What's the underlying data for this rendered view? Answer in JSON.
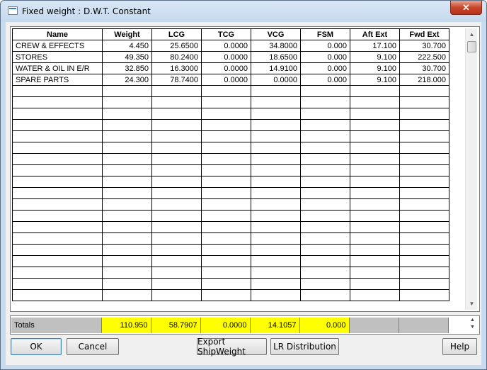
{
  "window": {
    "title": "Fixed weight : D.W.T. Constant",
    "close_label": "✕"
  },
  "table": {
    "columns": [
      "Name",
      "Weight",
      "LCG",
      "TCG",
      "VCG",
      "FSM",
      "Aft Ext",
      "Fwd Ext"
    ],
    "rows": [
      [
        "CREW & EFFECTS",
        "4.450",
        "25.6500",
        "0.0000",
        "34.8000",
        "0.000",
        "17.100",
        "30.700"
      ],
      [
        "STORES",
        "49.350",
        "80.2400",
        "0.0000",
        "18.6500",
        "0.000",
        "9.100",
        "222.500"
      ],
      [
        "WATER & OIL IN E/R",
        "32.850",
        "16.3000",
        "0.0000",
        "14.9100",
        "0.000",
        "9.100",
        "30.700"
      ],
      [
        "SPARE PARTS",
        "24.300",
        "78.7400",
        "0.0000",
        "0.0000",
        "0.000",
        "9.100",
        "218.000"
      ]
    ]
  },
  "totals": {
    "label": "Totals",
    "weight": "110.950",
    "lcg": "58.7907",
    "tcg": "0.0000",
    "vcg": "14.1057",
    "fsm": "0.000"
  },
  "buttons": {
    "ok": "OK",
    "cancel": "Cancel",
    "export": "Export ShipWeight",
    "lr_distribution": "LR Distribution",
    "help": "Help"
  },
  "colors": {
    "totals_highlight": "#ffff00",
    "totals_gray": "#c0c0c0",
    "close_button": "#c7452b"
  }
}
